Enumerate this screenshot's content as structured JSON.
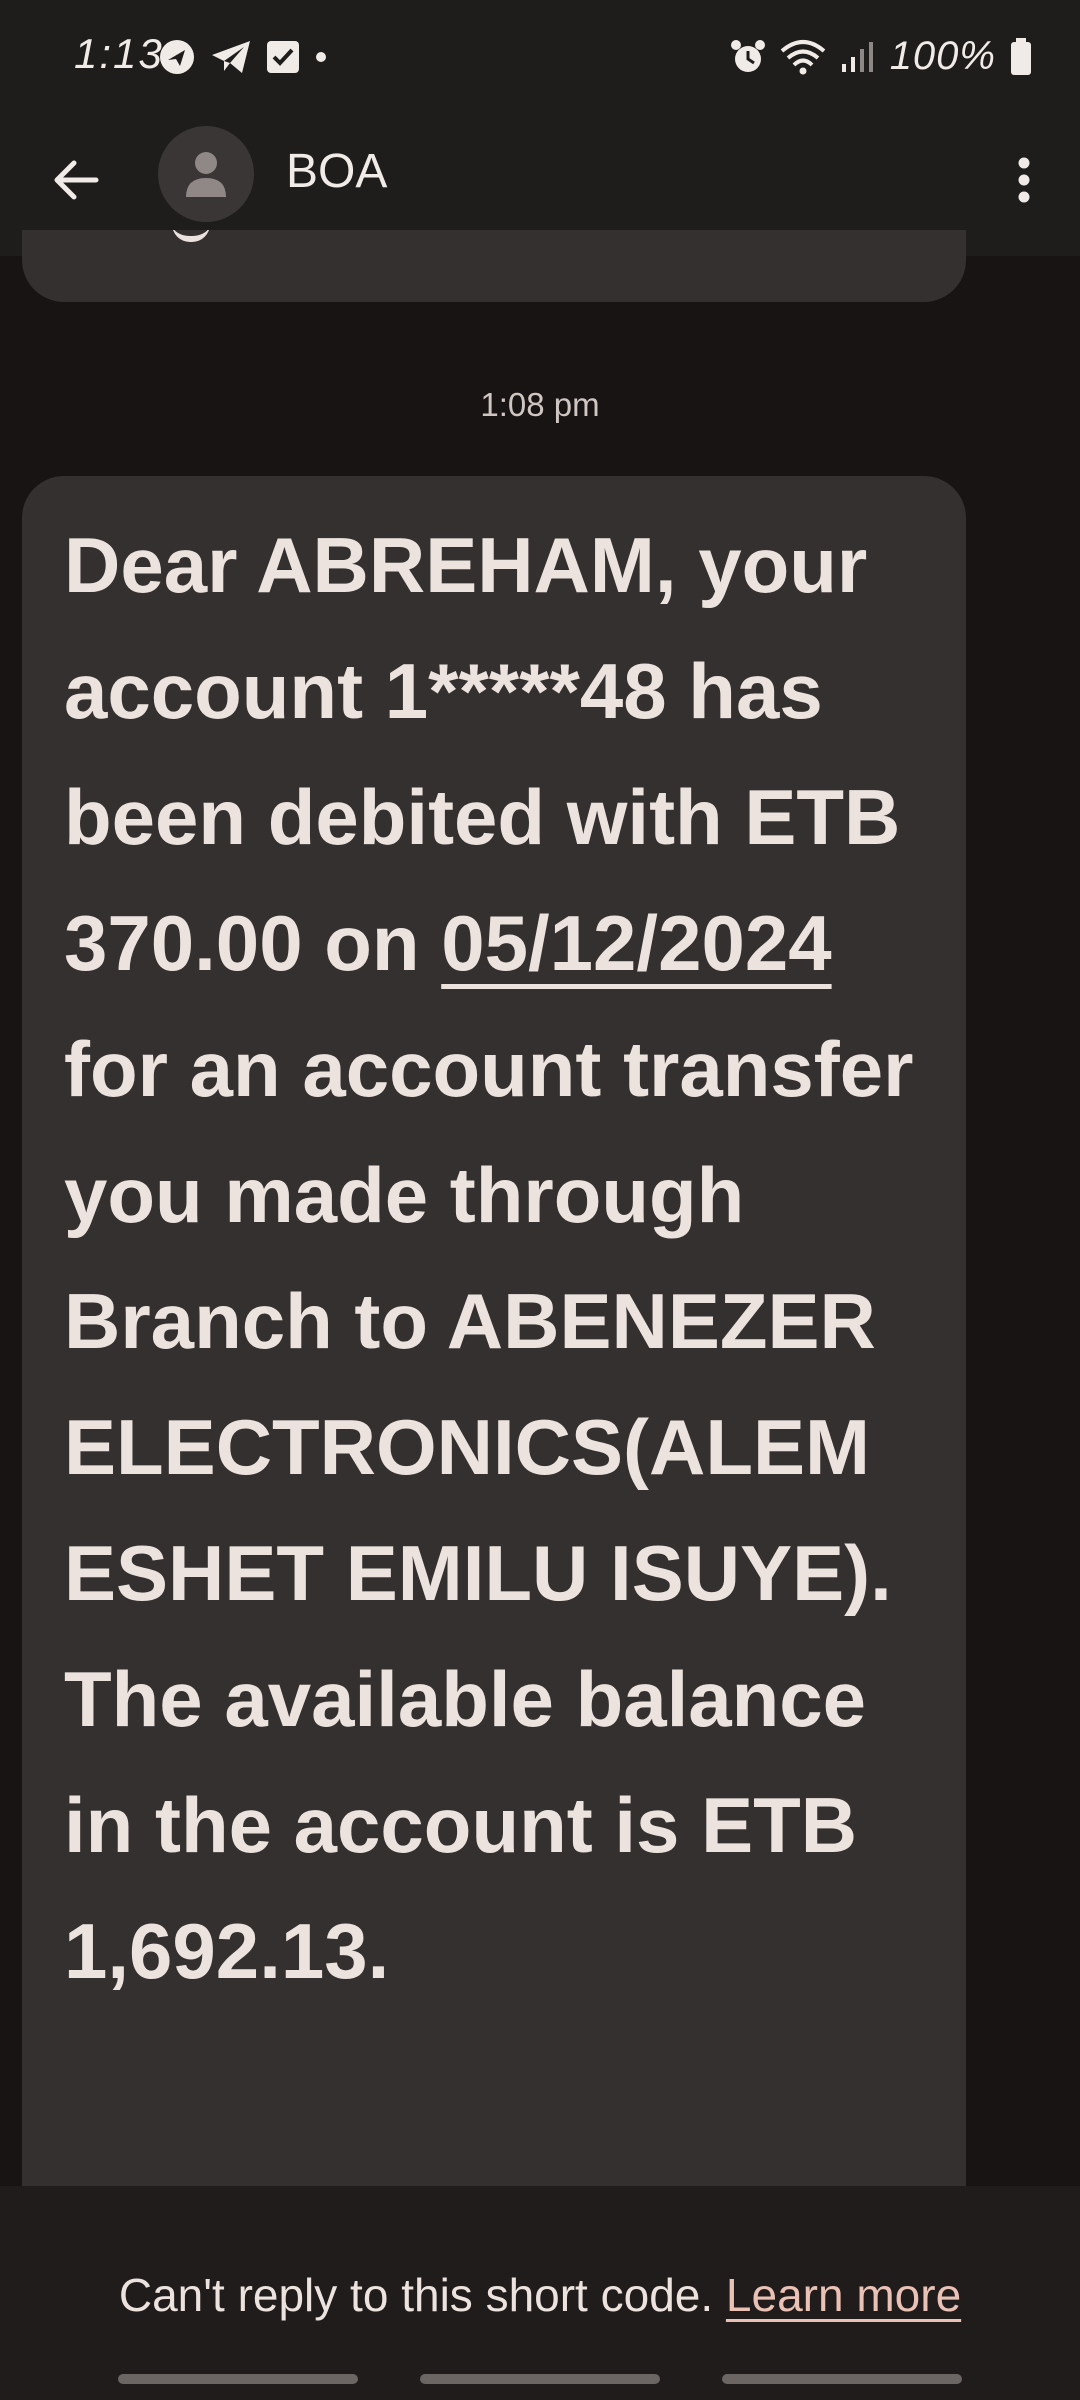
{
  "status_bar": {
    "time": "1:13",
    "battery_percent": "100%",
    "icons": [
      "chat-bubble-icon",
      "telegram-icon",
      "checkbox-icon",
      "dot-icon",
      "alarm-icon",
      "wifi-icon",
      "signal-icon",
      "battery-icon"
    ]
  },
  "header": {
    "contact_name": "BOA",
    "back_icon": "back-arrow-icon",
    "avatar_icon": "person-icon",
    "menu_icon": "more-vert-icon"
  },
  "conversation": {
    "timestamp": "1:08 pm",
    "message": {
      "before_date": "Dear ABREHAM, your account 1*****48 has been debited with ETB 370.00 on ",
      "date": "05/12/2024",
      "after_date": " for an account transfer you made through Branch to ABENEZER ELECTRONICS(ALEM ESHET EMILU ISUYE). The available balance in the account is ETB 1,692.13."
    }
  },
  "footer": {
    "notice": "Can't reply to this short code.",
    "learn_more_label": "Learn more"
  },
  "colors": {
    "background": "#181414",
    "bar": "#1f1c1c",
    "bubble": "#343030",
    "text": "#ece3de",
    "link": "#e9c1b5"
  }
}
